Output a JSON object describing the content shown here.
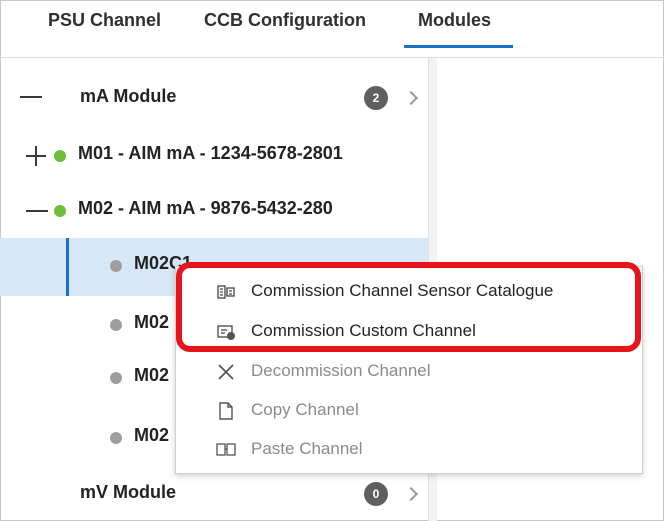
{
  "tabs": [
    {
      "label": "PSU Channel"
    },
    {
      "label": "CCB Configuration"
    },
    {
      "label": "Modules"
    }
  ],
  "tree": {
    "ma_module": {
      "label": "mA Module",
      "count": "2"
    },
    "m01": {
      "label": "M01 - AIM mA - 1234-5678-2801",
      "status_color": "#6dbf3a"
    },
    "m02": {
      "label": "M02 - AIM mA - 9876-5432-280",
      "status_color": "#6dbf3a"
    },
    "channels": [
      {
        "label": "M02C1"
      },
      {
        "label": "M02"
      },
      {
        "label": "M02"
      },
      {
        "label": "M02"
      }
    ],
    "channel_dot_color": "#9e9e9e",
    "mv_module": {
      "label": "mV Module",
      "count": "0"
    }
  },
  "context_menu": {
    "items": [
      {
        "label": "Commission Channel Sensor Catalogue",
        "icon": "sensor-catalogue-icon",
        "enabled": true
      },
      {
        "label": "Commission Custom Channel",
        "icon": "custom-channel-icon",
        "enabled": true
      },
      {
        "label": "Decommission Channel",
        "icon": "close-icon",
        "enabled": false
      },
      {
        "label": "Copy Channel",
        "icon": "copy-document-icon",
        "enabled": false
      },
      {
        "label": "Paste Channel",
        "icon": "paste-icon",
        "enabled": false
      }
    ]
  },
  "colors": {
    "accent": "#1a73c8",
    "highlight_box": "#e8141b",
    "selection_bg": "#d6e8f7"
  }
}
